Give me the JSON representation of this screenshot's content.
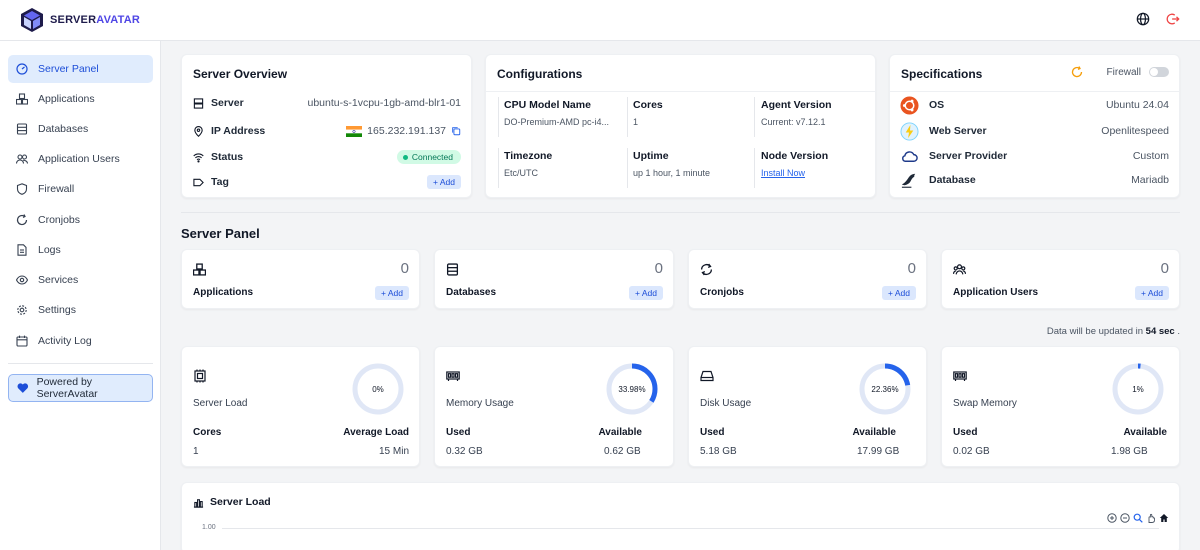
{
  "brand": {
    "name_a": "SERVER",
    "name_b": "AVATAR"
  },
  "sidebar": {
    "items": [
      {
        "label": "Server Panel",
        "icon": "gauge-icon",
        "active": true
      },
      {
        "label": "Applications",
        "icon": "cubes-icon"
      },
      {
        "label": "Databases",
        "icon": "database-icon"
      },
      {
        "label": "Application Users",
        "icon": "users-icon"
      },
      {
        "label": "Firewall",
        "icon": "shield-icon"
      },
      {
        "label": "Cronjobs",
        "icon": "refresh-icon"
      },
      {
        "label": "Logs",
        "icon": "file-icon"
      },
      {
        "label": "Services",
        "icon": "eye-icon"
      },
      {
        "label": "Settings",
        "icon": "gear-icon"
      },
      {
        "label": "Activity Log",
        "icon": "calendar-icon"
      }
    ],
    "powered": "Powered by ServerAvatar"
  },
  "overview": {
    "title": "Server Overview",
    "server_label": "Server",
    "server_value": "ubuntu-s-1vcpu-1gb-amd-blr1-01",
    "ip_label": "IP Address",
    "ip_value": "165.232.191.137",
    "status_label": "Status",
    "status_value": "Connected",
    "tag_label": "Tag",
    "tag_button": "+ Add"
  },
  "configurations": {
    "title": "Configurations",
    "cpu_label": "CPU Model Name",
    "cpu_value": "DO-Premium-AMD pc-i4...",
    "cores_label": "Cores",
    "cores_value": "1",
    "agent_label": "Agent Version",
    "agent_value": "Current: v7.12.1",
    "tz_label": "Timezone",
    "tz_value": "Etc/UTC",
    "uptime_label": "Uptime",
    "uptime_value": "up 1 hour, 1 minute",
    "node_label": "Node Version",
    "node_value": "Install Now"
  },
  "specifications": {
    "title": "Specifications",
    "firewall_label": "Firewall",
    "os_label": "OS",
    "os_value": "Ubuntu 24.04",
    "web_label": "Web Server",
    "web_value": "Openlitespeed",
    "provider_label": "Server Provider",
    "provider_value": "Custom",
    "db_label": "Database",
    "db_value": "Mariadb"
  },
  "server_panel": {
    "title": "Server Panel",
    "stats": [
      {
        "label": "Applications",
        "count": "0",
        "add": "+ Add"
      },
      {
        "label": "Databases",
        "count": "0",
        "add": "+ Add"
      },
      {
        "label": "Cronjobs",
        "count": "0",
        "add": "+ Add"
      },
      {
        "label": "Application Users",
        "count": "0",
        "add": "+ Add"
      }
    ]
  },
  "update_note": {
    "prefix": "Data will be updated in ",
    "time": "54 sec",
    "suffix": " ."
  },
  "resources": [
    {
      "title": "Server Load",
      "percent_text": "0%",
      "percent": 0,
      "k1": "Cores",
      "v1": "1",
      "k2": "Average Load",
      "v2": "15 Min"
    },
    {
      "title": "Memory Usage",
      "percent_text": "33.98%",
      "percent": 33.98,
      "k1": "Used",
      "v1": "0.32 GB",
      "k2": "Available",
      "v2": "0.62 GB"
    },
    {
      "title": "Disk Usage",
      "percent_text": "22.36%",
      "percent": 22.36,
      "k1": "Used",
      "v1": "5.18 GB",
      "k2": "Available",
      "v2": "17.99 GB"
    },
    {
      "title": "Swap Memory",
      "percent_text": "1%",
      "percent": 1,
      "k1": "Used",
      "v1": "0.02 GB",
      "k2": "Available",
      "v2": "1.98 GB"
    }
  ],
  "load_chart": {
    "title": "Server Load",
    "ytick": "1.00"
  },
  "colors": {
    "accent": "#2563eb",
    "active_bg": "#e0ecfd",
    "gauge_track": "#e0e7f6"
  }
}
